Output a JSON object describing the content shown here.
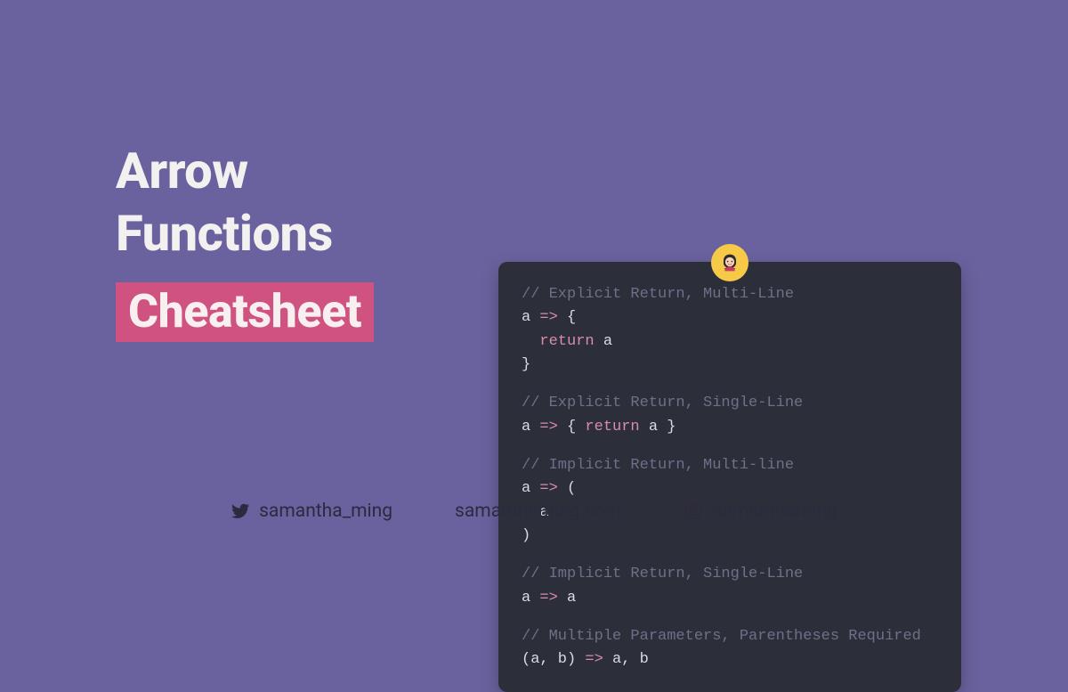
{
  "title": {
    "line1": "Arrow",
    "line2": "Functions",
    "highlight": "Cheatsheet"
  },
  "code": {
    "lines": [
      {
        "type": "comment",
        "text": "// Explicit Return, Multi-Line"
      },
      {
        "type": "tokens",
        "parts": [
          {
            "cls": "ident",
            "t": "a "
          },
          {
            "cls": "arrow",
            "t": "=>"
          },
          {
            "cls": "ident",
            "t": " "
          },
          {
            "cls": "brace",
            "t": "{"
          }
        ]
      },
      {
        "type": "tokens",
        "parts": [
          {
            "cls": "ident",
            "t": "  "
          },
          {
            "cls": "kw",
            "t": "return"
          },
          {
            "cls": "ident",
            "t": " a"
          }
        ]
      },
      {
        "type": "tokens",
        "parts": [
          {
            "cls": "brace",
            "t": "}"
          }
        ]
      },
      {
        "type": "blank"
      },
      {
        "type": "comment",
        "text": "// Explicit Return, Single-Line"
      },
      {
        "type": "tokens",
        "parts": [
          {
            "cls": "ident",
            "t": "a "
          },
          {
            "cls": "arrow",
            "t": "=>"
          },
          {
            "cls": "ident",
            "t": " "
          },
          {
            "cls": "brace",
            "t": "{"
          },
          {
            "cls": "ident",
            "t": " "
          },
          {
            "cls": "kw",
            "t": "return"
          },
          {
            "cls": "ident",
            "t": " a "
          },
          {
            "cls": "brace",
            "t": "}"
          }
        ]
      },
      {
        "type": "blank"
      },
      {
        "type": "comment",
        "text": "// Implicit Return, Multi-line"
      },
      {
        "type": "tokens",
        "parts": [
          {
            "cls": "ident",
            "t": "a "
          },
          {
            "cls": "arrow",
            "t": "=>"
          },
          {
            "cls": "ident",
            "t": " "
          },
          {
            "cls": "brace",
            "t": "("
          }
        ]
      },
      {
        "type": "tokens",
        "parts": [
          {
            "cls": "ident",
            "t": "  a"
          }
        ]
      },
      {
        "type": "tokens",
        "parts": [
          {
            "cls": "brace",
            "t": ")"
          }
        ]
      },
      {
        "type": "blank"
      },
      {
        "type": "comment",
        "text": "// Implicit Return, Single-Line"
      },
      {
        "type": "tokens",
        "parts": [
          {
            "cls": "ident",
            "t": "a "
          },
          {
            "cls": "arrow",
            "t": "=>"
          },
          {
            "cls": "ident",
            "t": " a"
          }
        ]
      },
      {
        "type": "blank"
      },
      {
        "type": "comment",
        "text": "// Multiple Parameters, Parentheses Required"
      },
      {
        "type": "tokens",
        "parts": [
          {
            "cls": "brace",
            "t": "("
          },
          {
            "cls": "ident",
            "t": "a, b"
          },
          {
            "cls": "brace",
            "t": ")"
          },
          {
            "cls": "ident",
            "t": " "
          },
          {
            "cls": "arrow",
            "t": "=>"
          },
          {
            "cls": "ident",
            "t": " a, b"
          }
        ]
      }
    ]
  },
  "footer": {
    "twitter": "samantha_ming",
    "website": "samanthaming.com",
    "instagram": "samanthaming"
  }
}
